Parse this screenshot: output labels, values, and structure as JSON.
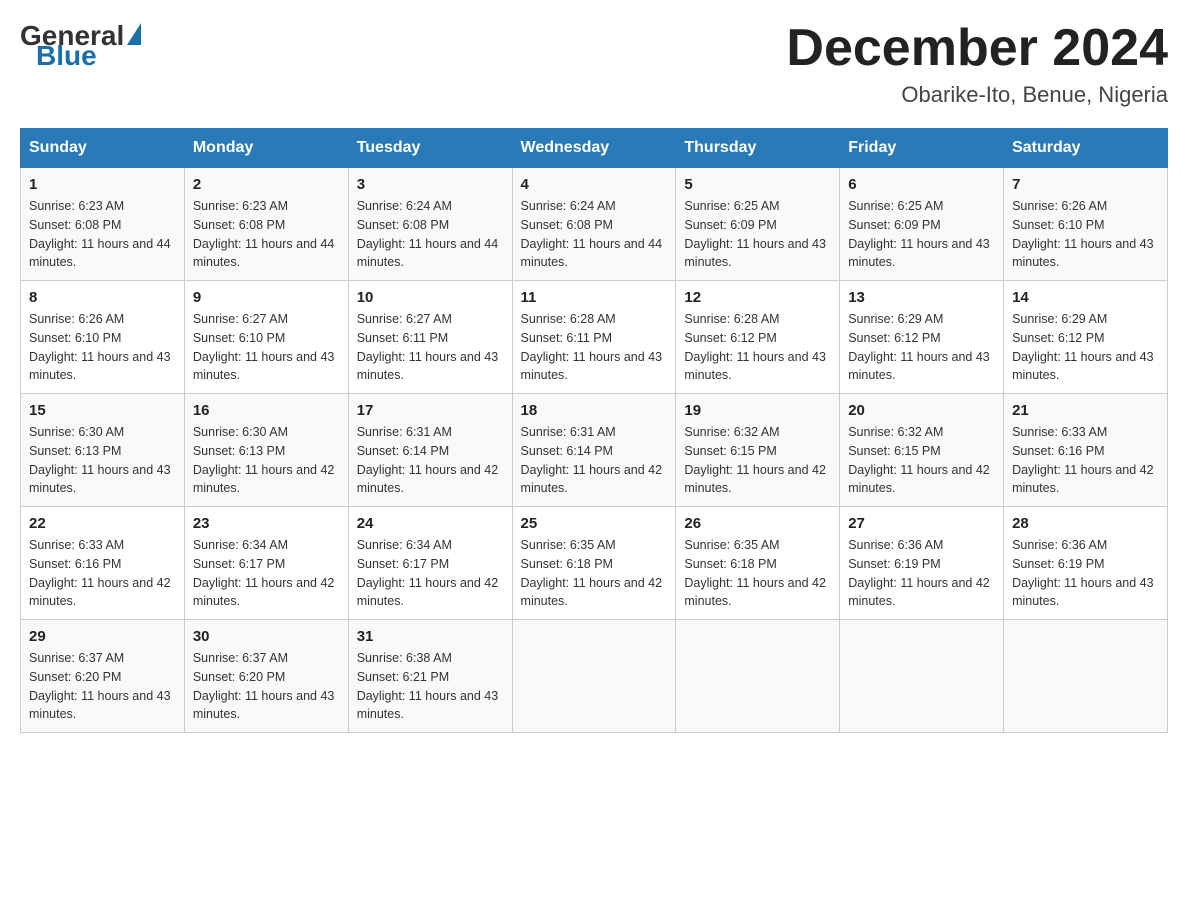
{
  "header": {
    "logo_general": "General",
    "logo_blue": "Blue",
    "month_year": "December 2024",
    "location": "Obarike-Ito, Benue, Nigeria"
  },
  "days_of_week": [
    "Sunday",
    "Monday",
    "Tuesday",
    "Wednesday",
    "Thursday",
    "Friday",
    "Saturday"
  ],
  "weeks": [
    [
      {
        "day": "1",
        "sunrise": "6:23 AM",
        "sunset": "6:08 PM",
        "daylight": "11 hours and 44 minutes."
      },
      {
        "day": "2",
        "sunrise": "6:23 AM",
        "sunset": "6:08 PM",
        "daylight": "11 hours and 44 minutes."
      },
      {
        "day": "3",
        "sunrise": "6:24 AM",
        "sunset": "6:08 PM",
        "daylight": "11 hours and 44 minutes."
      },
      {
        "day": "4",
        "sunrise": "6:24 AM",
        "sunset": "6:08 PM",
        "daylight": "11 hours and 44 minutes."
      },
      {
        "day": "5",
        "sunrise": "6:25 AM",
        "sunset": "6:09 PM",
        "daylight": "11 hours and 43 minutes."
      },
      {
        "day": "6",
        "sunrise": "6:25 AM",
        "sunset": "6:09 PM",
        "daylight": "11 hours and 43 minutes."
      },
      {
        "day": "7",
        "sunrise": "6:26 AM",
        "sunset": "6:10 PM",
        "daylight": "11 hours and 43 minutes."
      }
    ],
    [
      {
        "day": "8",
        "sunrise": "6:26 AM",
        "sunset": "6:10 PM",
        "daylight": "11 hours and 43 minutes."
      },
      {
        "day": "9",
        "sunrise": "6:27 AM",
        "sunset": "6:10 PM",
        "daylight": "11 hours and 43 minutes."
      },
      {
        "day": "10",
        "sunrise": "6:27 AM",
        "sunset": "6:11 PM",
        "daylight": "11 hours and 43 minutes."
      },
      {
        "day": "11",
        "sunrise": "6:28 AM",
        "sunset": "6:11 PM",
        "daylight": "11 hours and 43 minutes."
      },
      {
        "day": "12",
        "sunrise": "6:28 AM",
        "sunset": "6:12 PM",
        "daylight": "11 hours and 43 minutes."
      },
      {
        "day": "13",
        "sunrise": "6:29 AM",
        "sunset": "6:12 PM",
        "daylight": "11 hours and 43 minutes."
      },
      {
        "day": "14",
        "sunrise": "6:29 AM",
        "sunset": "6:12 PM",
        "daylight": "11 hours and 43 minutes."
      }
    ],
    [
      {
        "day": "15",
        "sunrise": "6:30 AM",
        "sunset": "6:13 PM",
        "daylight": "11 hours and 43 minutes."
      },
      {
        "day": "16",
        "sunrise": "6:30 AM",
        "sunset": "6:13 PM",
        "daylight": "11 hours and 42 minutes."
      },
      {
        "day": "17",
        "sunrise": "6:31 AM",
        "sunset": "6:14 PM",
        "daylight": "11 hours and 42 minutes."
      },
      {
        "day": "18",
        "sunrise": "6:31 AM",
        "sunset": "6:14 PM",
        "daylight": "11 hours and 42 minutes."
      },
      {
        "day": "19",
        "sunrise": "6:32 AM",
        "sunset": "6:15 PM",
        "daylight": "11 hours and 42 minutes."
      },
      {
        "day": "20",
        "sunrise": "6:32 AM",
        "sunset": "6:15 PM",
        "daylight": "11 hours and 42 minutes."
      },
      {
        "day": "21",
        "sunrise": "6:33 AM",
        "sunset": "6:16 PM",
        "daylight": "11 hours and 42 minutes."
      }
    ],
    [
      {
        "day": "22",
        "sunrise": "6:33 AM",
        "sunset": "6:16 PM",
        "daylight": "11 hours and 42 minutes."
      },
      {
        "day": "23",
        "sunrise": "6:34 AM",
        "sunset": "6:17 PM",
        "daylight": "11 hours and 42 minutes."
      },
      {
        "day": "24",
        "sunrise": "6:34 AM",
        "sunset": "6:17 PM",
        "daylight": "11 hours and 42 minutes."
      },
      {
        "day": "25",
        "sunrise": "6:35 AM",
        "sunset": "6:18 PM",
        "daylight": "11 hours and 42 minutes."
      },
      {
        "day": "26",
        "sunrise": "6:35 AM",
        "sunset": "6:18 PM",
        "daylight": "11 hours and 42 minutes."
      },
      {
        "day": "27",
        "sunrise": "6:36 AM",
        "sunset": "6:19 PM",
        "daylight": "11 hours and 42 minutes."
      },
      {
        "day": "28",
        "sunrise": "6:36 AM",
        "sunset": "6:19 PM",
        "daylight": "11 hours and 43 minutes."
      }
    ],
    [
      {
        "day": "29",
        "sunrise": "6:37 AM",
        "sunset": "6:20 PM",
        "daylight": "11 hours and 43 minutes."
      },
      {
        "day": "30",
        "sunrise": "6:37 AM",
        "sunset": "6:20 PM",
        "daylight": "11 hours and 43 minutes."
      },
      {
        "day": "31",
        "sunrise": "6:38 AM",
        "sunset": "6:21 PM",
        "daylight": "11 hours and 43 minutes."
      },
      {
        "day": "",
        "sunrise": "",
        "sunset": "",
        "daylight": ""
      },
      {
        "day": "",
        "sunrise": "",
        "sunset": "",
        "daylight": ""
      },
      {
        "day": "",
        "sunrise": "",
        "sunset": "",
        "daylight": ""
      },
      {
        "day": "",
        "sunrise": "",
        "sunset": "",
        "daylight": ""
      }
    ]
  ]
}
